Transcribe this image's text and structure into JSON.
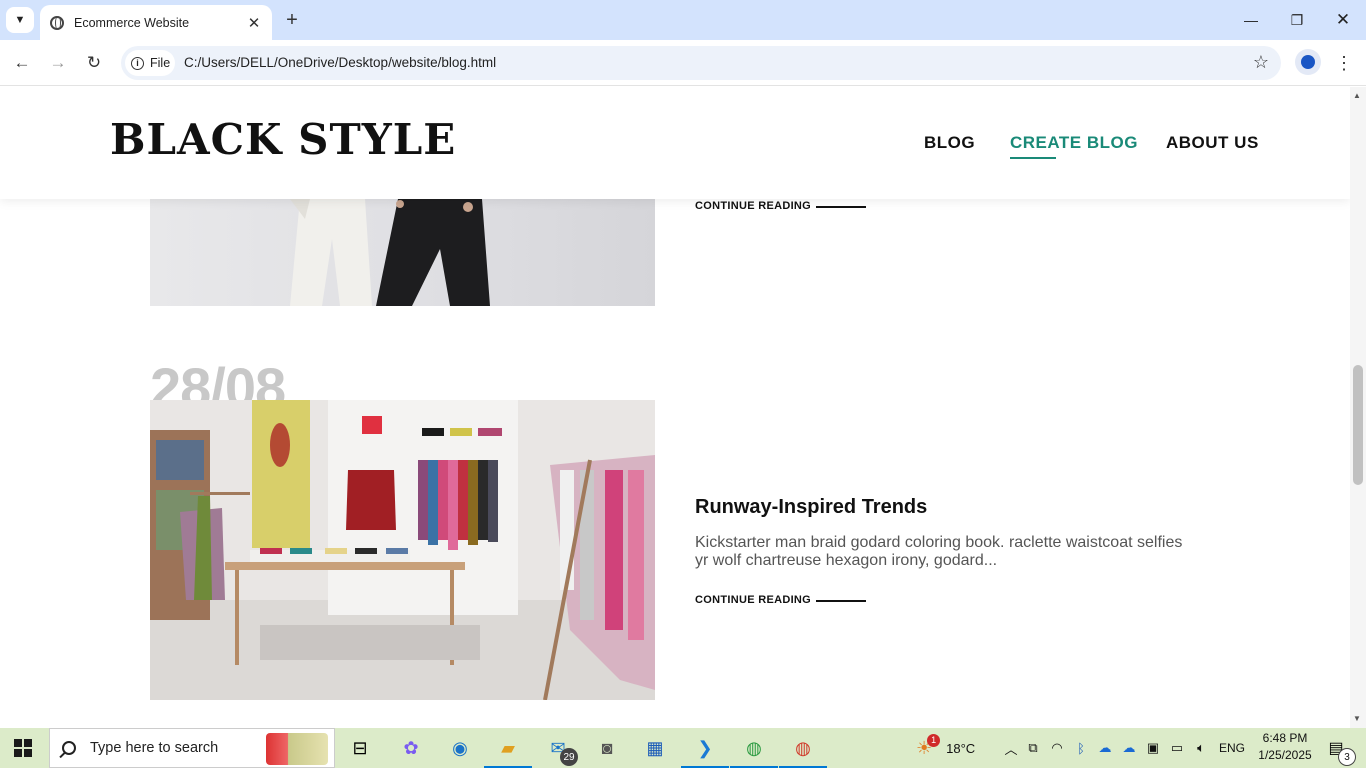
{
  "browser": {
    "tab_title": "Ecommerce Website",
    "url_chip": "File",
    "url": "C:/Users/DELL/OneDrive/Desktop/website/blog.html"
  },
  "site": {
    "logo": "BLACK STYLE",
    "nav": [
      {
        "label": "BLOG",
        "active": false
      },
      {
        "label": "CREATE BLOG",
        "active": true
      },
      {
        "label": "ABOUT US",
        "active": false
      }
    ],
    "accent_color": "#1a8a78"
  },
  "posts": [
    {
      "continue_label": "CONTINUE READING"
    },
    {
      "date": "28/08",
      "title": "Runway-Inspired Trends",
      "excerpt": "Kickstarter man braid godard coloring book. raclette waistcoat selfies yr wolf chartreuse hexagon irony, godard...",
      "continue_label": "CONTINUE READING"
    }
  ],
  "taskbar": {
    "search_placeholder": "Type here to search",
    "mail_badge": "29",
    "weather_badge": "1",
    "temperature": "18°C",
    "language": "ENG",
    "time": "6:48 PM",
    "date": "1/25/2025",
    "notification_count": "3"
  }
}
